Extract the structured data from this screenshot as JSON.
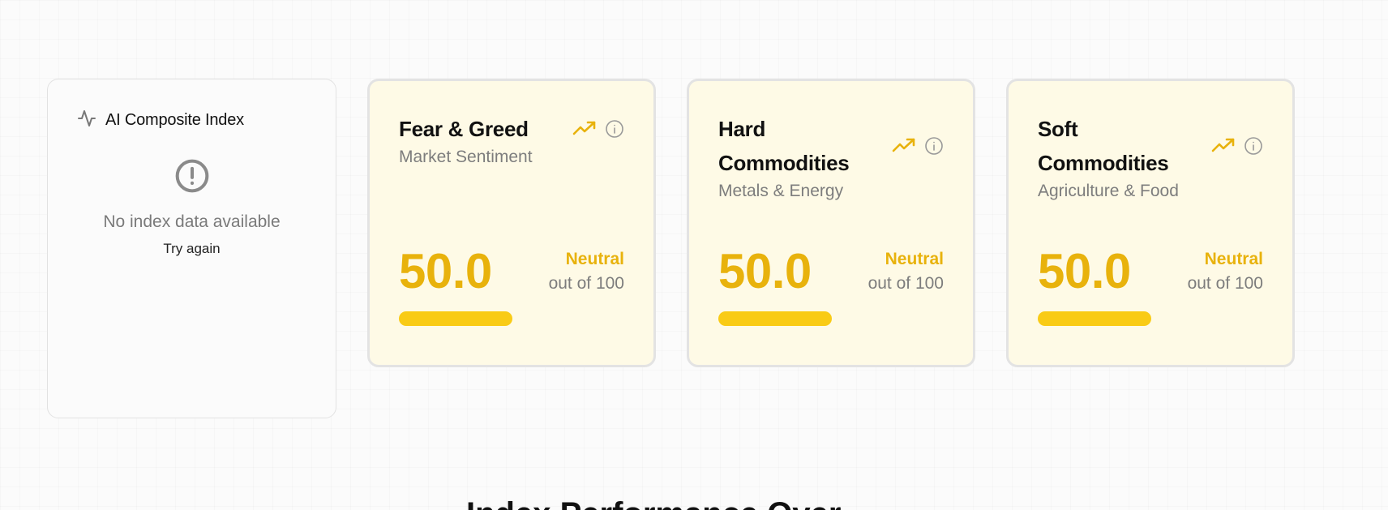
{
  "ai_card": {
    "title": "AI Composite Index",
    "empty_message": "No index data available",
    "retry_label": "Try again"
  },
  "index_cards": [
    {
      "title": "Fear & Greed",
      "subtitle": "Market Sentiment",
      "value": "50.0",
      "status": "Neutral",
      "scale": "out of 100",
      "progress": 0.5
    },
    {
      "title": "Hard Commodities",
      "subtitle": "Metals & Energy",
      "value": "50.0",
      "status": "Neutral",
      "scale": "out of 100",
      "progress": 0.5
    },
    {
      "title": "Soft Commodities",
      "subtitle": "Agriculture & Food",
      "value": "50.0",
      "status": "Neutral",
      "scale": "out of 100",
      "progress": 0.5
    }
  ],
  "section": {
    "heading": "Index Performance Over"
  },
  "colors": {
    "accent": "#e8b20c",
    "bar": "#f9cb16",
    "card_bg": "#fefae6",
    "icon_gray": "#8a8a8a"
  }
}
